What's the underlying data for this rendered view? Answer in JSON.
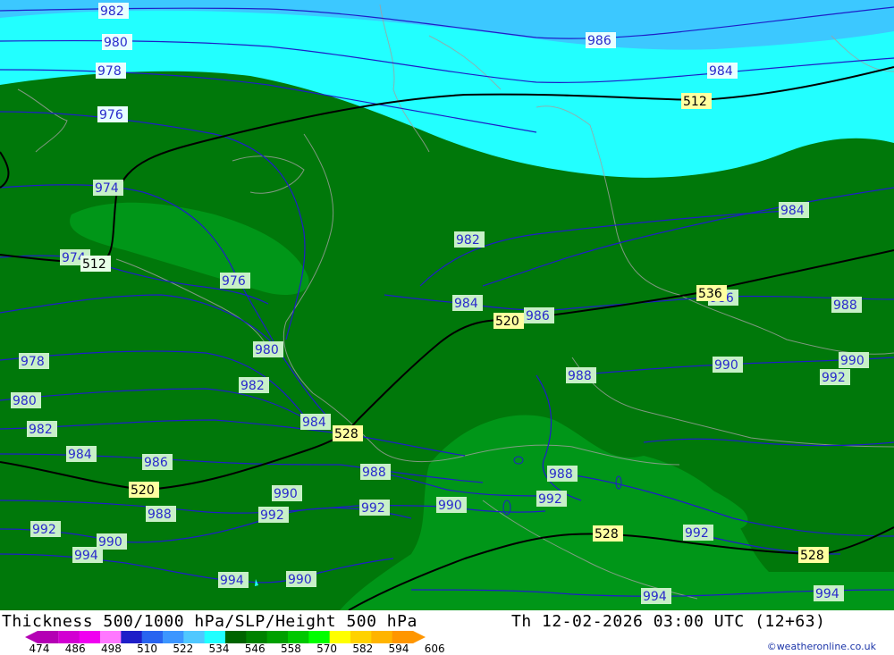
{
  "title": "Thickness 500/1000 hPa/SLP/Height 500 hPa",
  "datetime": "Th 12-02-2026 03:00 UTC (12+63)",
  "credit": "©weatheronline.co.uk",
  "colorbar": {
    "ticks": [
      "474",
      "486",
      "498",
      "510",
      "522",
      "534",
      "546",
      "558",
      "570",
      "582",
      "594",
      "606"
    ],
    "colors": [
      "#b400b4",
      "#d200d2",
      "#f000f0",
      "#ff78ff",
      "#1e1ec8",
      "#2864f0",
      "#3c96ff",
      "#50c8ff",
      "#20ffff",
      "#006400",
      "#008200",
      "#00a000",
      "#00c800",
      "#00ff00",
      "#ffff00",
      "#ffd200",
      "#ffb400",
      "#ff9600"
    ]
  },
  "map": {
    "pressure_labels": [
      "982",
      "980",
      "978",
      "976",
      "974",
      "974",
      "976",
      "986",
      "984",
      "984",
      "982",
      "984",
      "986",
      "988",
      "990",
      "990",
      "992",
      "988",
      "978",
      "980",
      "982",
      "984",
      "986",
      "980",
      "982",
      "984",
      "986",
      "988",
      "990",
      "992",
      "994",
      "994",
      "990",
      "988",
      "990",
      "992",
      "990",
      "992",
      "988",
      "992",
      "992",
      "994",
      "994"
    ],
    "thickness_labels": [
      "512",
      "512",
      "520",
      "528",
      "520",
      "528",
      "528",
      "536",
      "536"
    ]
  }
}
